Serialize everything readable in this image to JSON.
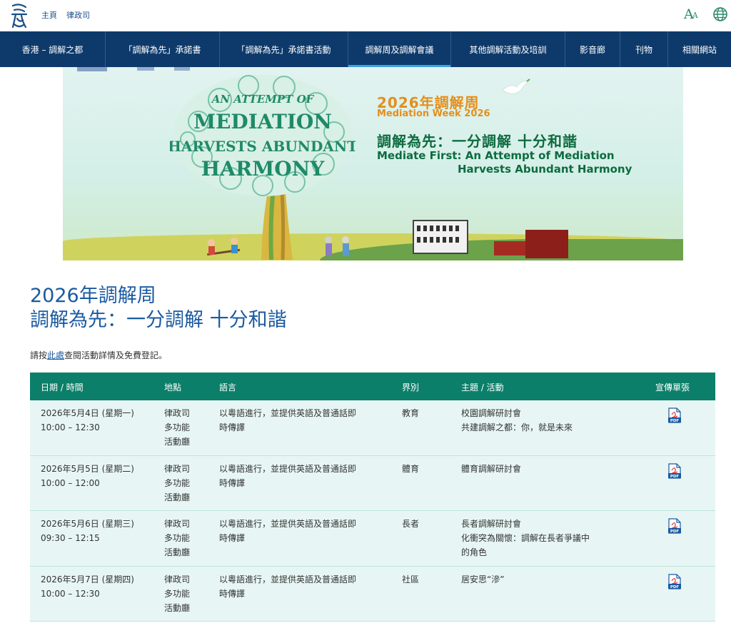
{
  "header": {
    "home_link": "主頁",
    "doj_link": "律政司"
  },
  "nav": {
    "items": [
      {
        "label": "香港 – 調解之都",
        "active": false
      },
      {
        "label": "「調解為先」承諾書",
        "active": false
      },
      {
        "label": "「調解為先」承諾書活動",
        "active": false
      },
      {
        "label": "調解周及調解會議",
        "active": true
      },
      {
        "label": "其他調解活動及培訓",
        "active": false
      },
      {
        "label": "影音廊",
        "active": false
      },
      {
        "label": "刊物",
        "active": false
      },
      {
        "label": "相關網站",
        "active": false
      }
    ]
  },
  "banner": {
    "tree_text_lines": [
      "AN ATTEMPT OF",
      "MEDIATION",
      "HARVESTS ABUNDANT",
      "HARMONY"
    ],
    "title_cn": "2026年調解周",
    "title_en": "Mediation Week 2026",
    "slogan_cn": "調解為先：一分調解 十分和諧",
    "slogan_en_line1": "Mediate First:  An Attempt of Mediation",
    "slogan_en_line2": "Harvests Abundant Harmony"
  },
  "page": {
    "title": "2026年調解周",
    "subtitle": "調解為先：一分調解 十分和諧",
    "intro_before": "請按",
    "intro_link": "此處",
    "intro_after": "查閱活動詳情及免費登記。"
  },
  "table": {
    "headers": [
      "日期 / 時間",
      "地點",
      "語言",
      "界別",
      "主題 / 活動",
      "宣傳單張"
    ],
    "rows": [
      {
        "date": "2026年5月4日 (星期一)",
        "time": "10:00 – 12:30",
        "venue": [
          "律政司",
          "多功能",
          "活動廳"
        ],
        "language": [
          "以粵語進行，並提供英語及普通話即",
          "時傳譯"
        ],
        "sector": "教育",
        "topic": [
          "校園調解研討會",
          "共建調解之都：你，就是未來"
        ]
      },
      {
        "date": "2026年5月5日 (星期二)",
        "time": "10:00 – 12:00",
        "venue": [
          "律政司",
          "多功能",
          "活動廳"
        ],
        "language": [
          "以粵語進行，並提供英語及普通話即",
          "時傳譯"
        ],
        "sector": "體育",
        "topic": [
          "體育調解研討會"
        ]
      },
      {
        "date": "2026年5月6日 (星期三)",
        "time": "09:30 – 12:15",
        "venue": [
          "律政司",
          "多功能",
          "活動廳"
        ],
        "language": [
          "以粵語進行，並提供英語及普通話即",
          "時傳譯"
        ],
        "sector": "長者",
        "topic": [
          "長者調解研討會",
          "化衝突為關懷：調解在長者爭議中",
          "的角色"
        ]
      },
      {
        "date": "2026年5月7日 (星期四)",
        "time": "10:00 – 12:30",
        "venue": [
          "律政司",
          "多功能",
          "活動廳"
        ],
        "language": [
          "以粵語進行，並提供英語及普通話即",
          "時傳譯"
        ],
        "sector": "社區",
        "topic": [
          "居安思“滲”"
        ]
      }
    ],
    "pdf_label": "PDF"
  },
  "icons": {
    "accessibility": "text-size-icon",
    "language": "globe-icon",
    "flyer": "pdf-icon"
  },
  "colors": {
    "nav_bg": "#0e3a6b",
    "table_header_bg": "#0b7f6a",
    "row_bg": "#e7f6f4",
    "title_color": "#1a5aa0",
    "accent_orange": "#e48f1b",
    "accent_green": "#0d6b3f"
  }
}
